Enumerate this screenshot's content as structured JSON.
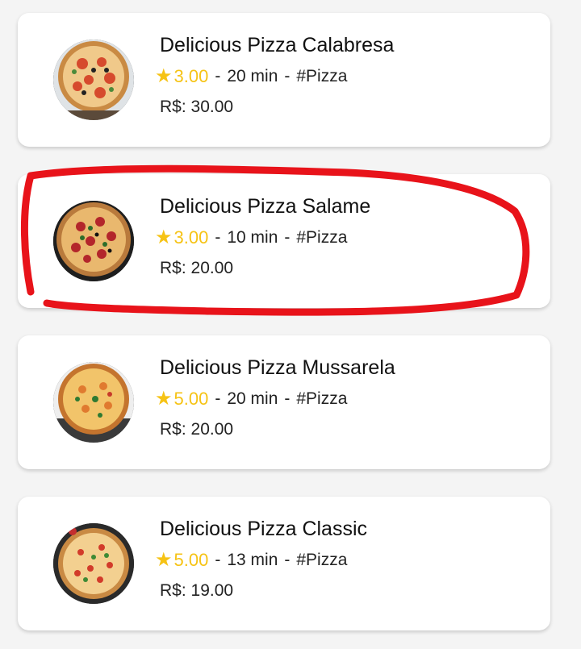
{
  "products": [
    {
      "name": "Delicious Pizza Calabresa",
      "rating": "3.00",
      "time": "20 min",
      "tag": "#Pizza",
      "price": "R$: 30.00",
      "image_icon": "pizza-calabresa-photo"
    },
    {
      "name": "Delicious Pizza Salame",
      "rating": "3.00",
      "time": "10 min",
      "tag": "#Pizza",
      "price": "R$: 20.00",
      "image_icon": "pizza-salame-photo"
    },
    {
      "name": "Delicious Pizza Mussarela",
      "rating": "5.00",
      "time": "20 min",
      "tag": "#Pizza",
      "price": "R$: 20.00",
      "image_icon": "pizza-mussarela-photo"
    },
    {
      "name": "Delicious Pizza Classic",
      "rating": "5.00",
      "time": "13 min",
      "tag": "#Pizza",
      "price": "R$: 19.00",
      "image_icon": "pizza-classic-photo"
    }
  ],
  "separator": "-",
  "star_glyph": "★",
  "colors": {
    "rating": "#f6c315",
    "highlight": "#e8131a"
  },
  "annotation": {
    "highlighted_item": "Delicious Pizza Salame"
  }
}
